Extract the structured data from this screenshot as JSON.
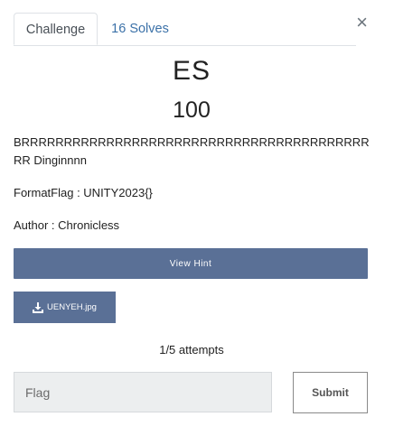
{
  "modal": {
    "close_glyph": "×",
    "tabs": [
      {
        "label": "Challenge",
        "active": true
      },
      {
        "label": "16 Solves",
        "active": false
      }
    ],
    "challenge": {
      "name": "ES",
      "points": "100",
      "description": "BRRRRRRRRRRRRRRRRRRRRRRRRRRRRRRRRRRRRRRRRRRR Dinginnnn",
      "format_flag": "FormatFlag : UNITY2023{}",
      "author": "Author : Chronicless"
    },
    "hint_button_label": "View Hint",
    "file_button": {
      "icon": "download-icon",
      "label": "UENYEH.jpg"
    },
    "attempts": "1/5 attempts",
    "flag_input": {
      "placeholder": "Flag",
      "value": ""
    },
    "submit_label": "Submit",
    "colors": {
      "primary": "#5a7096",
      "link": "#3b71a8"
    }
  }
}
